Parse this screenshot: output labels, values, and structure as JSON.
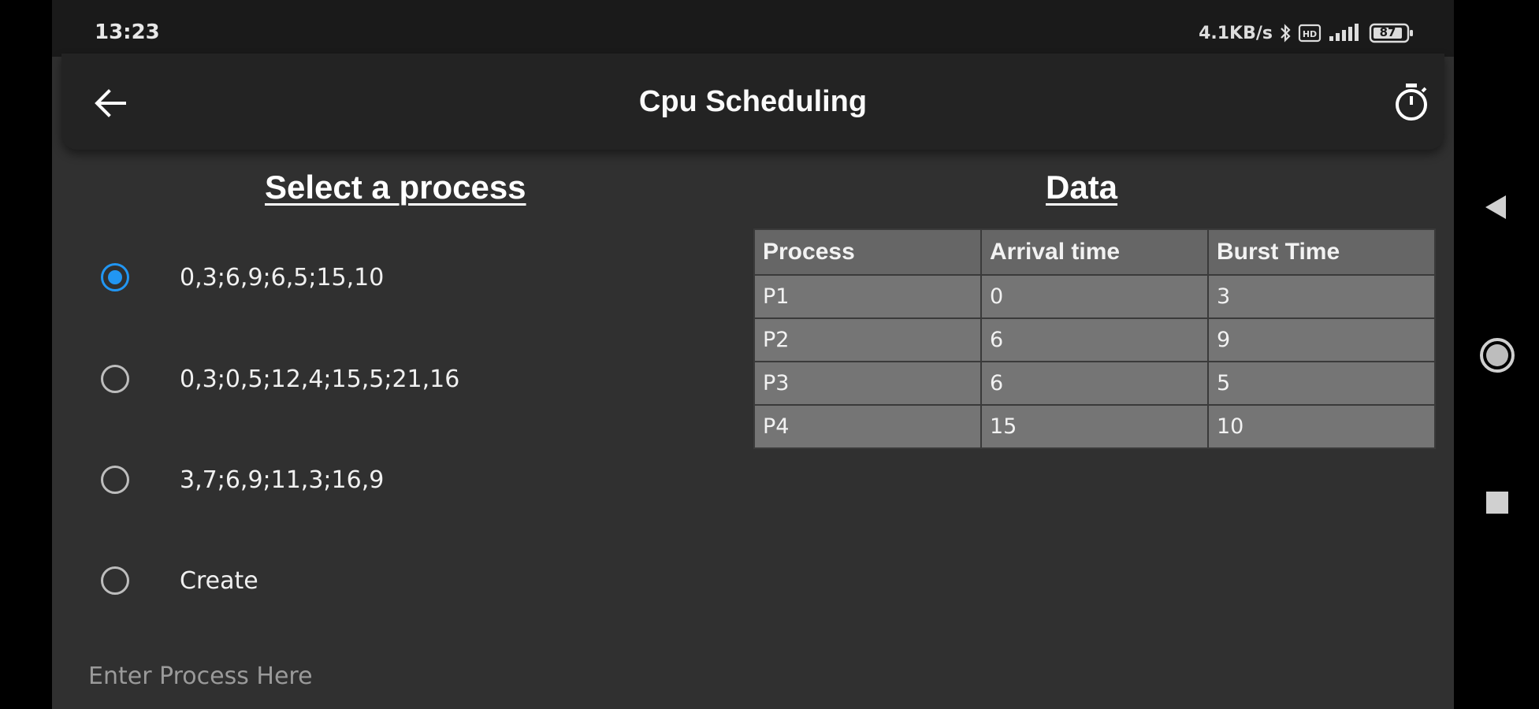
{
  "status_bar": {
    "time": "13:23",
    "network_speed": "4.1KB/s",
    "battery": "87",
    "icons": [
      "bluetooth-icon",
      "hd-icon",
      "signal-icon",
      "battery-icon"
    ]
  },
  "app_bar": {
    "title": "Cpu Scheduling",
    "back_icon": "arrow-left-icon",
    "timer_icon": "stopwatch-icon"
  },
  "left_panel": {
    "title": "Select a process",
    "options": [
      {
        "label": "0,3;6,9;6,5;15,10",
        "selected": true
      },
      {
        "label": "0,3;0,5;12,4;15,5;21,16",
        "selected": false
      },
      {
        "label": "3,7;6,9;11,3;16,9",
        "selected": false
      },
      {
        "label": "Create",
        "selected": false
      }
    ],
    "input": {
      "placeholder": "Enter Process Here",
      "value": ""
    }
  },
  "right_panel": {
    "title": "Data",
    "table": {
      "headers": [
        "Process",
        "Arrival time",
        "Burst Time"
      ],
      "rows": [
        [
          "P1",
          "0",
          "3"
        ],
        [
          "P2",
          "6",
          "9"
        ],
        [
          "P3",
          "6",
          "5"
        ],
        [
          "P4",
          "15",
          "10"
        ]
      ]
    }
  },
  "colors": {
    "accent": "#2196f3",
    "background": "#303030",
    "app_bar": "#232323",
    "table_cell": "#757575"
  },
  "nav_bar": {
    "buttons": [
      "back-triangle-icon",
      "home-circle-icon",
      "recents-square-icon"
    ]
  }
}
